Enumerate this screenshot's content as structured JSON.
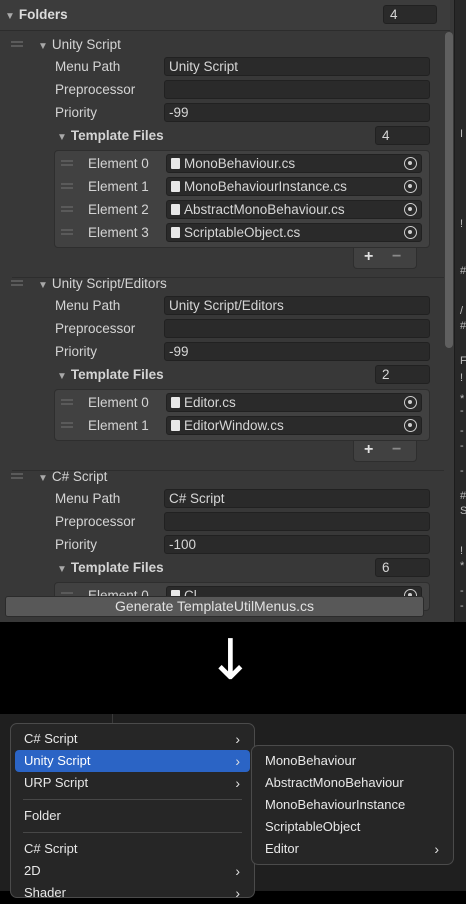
{
  "folders": {
    "header": "Folders",
    "count": "4"
  },
  "blocks": [
    {
      "title": "Unity Script",
      "labels": {
        "menu_path": "Menu Path",
        "preprocessor": "Preprocessor",
        "priority": "Priority"
      },
      "menu_path": "Unity Script",
      "preprocessor": "",
      "priority": "-99",
      "template_files_label": "Template Files",
      "template_count": "4",
      "elements": [
        {
          "label": "Element 0",
          "file": "MonoBehaviour.cs"
        },
        {
          "label": "Element 1",
          "file": "MonoBehaviourInstance.cs"
        },
        {
          "label": "Element 2",
          "file": "AbstractMonoBehaviour.cs"
        },
        {
          "label": "Element 3",
          "file": "ScriptableObject.cs"
        }
      ]
    },
    {
      "title": "Unity Script/Editors",
      "labels": {
        "menu_path": "Menu Path",
        "preprocessor": "Preprocessor",
        "priority": "Priority"
      },
      "menu_path": "Unity Script/Editors",
      "preprocessor": "",
      "priority": "-99",
      "template_files_label": "Template Files",
      "template_count": "2",
      "elements": [
        {
          "label": "Element 0",
          "file": "Editor.cs"
        },
        {
          "label": "Element 1",
          "file": "EditorWindow.cs"
        }
      ]
    },
    {
      "title": "C# Script",
      "labels": {
        "menu_path": "Menu Path",
        "preprocessor": "Preprocessor",
        "priority": "Priority"
      },
      "menu_path": "C# Script",
      "preprocessor": "",
      "priority": "-100",
      "template_files_label": "Template Files",
      "template_count": "6",
      "elements": [
        {
          "label": "Element 0",
          "file": "Cl..."
        }
      ]
    }
  ],
  "list_controls": {
    "add": "+",
    "remove": "−"
  },
  "generate_button": "Generate TemplateUtilMenus.cs",
  "right_pane": [
    "I",
    "!",
    "#",
    "/",
    "#",
    "F",
    "!",
    "*",
    "-",
    "-",
    "-",
    "-",
    "#",
    "S",
    "!",
    "*",
    "-",
    "-"
  ],
  "arrow": "↓",
  "context_menu": {
    "items": [
      {
        "label": "C# Script",
        "submenu": true
      },
      {
        "label": "Unity Script",
        "submenu": true,
        "selected": true
      },
      {
        "label": "URP Script",
        "submenu": true
      },
      {
        "label": "Folder",
        "submenu": false
      },
      {
        "label": "C# Script",
        "submenu": false
      },
      {
        "label": "2D",
        "submenu": true
      },
      {
        "label": "Shader",
        "submenu": true
      }
    ],
    "chevron": "›"
  },
  "submenu": {
    "items": [
      {
        "label": "MonoBehaviour",
        "submenu": false
      },
      {
        "label": "AbstractMonoBehaviour",
        "submenu": false
      },
      {
        "label": "MonoBehaviourInstance",
        "submenu": false
      },
      {
        "label": "ScriptableObject",
        "submenu": false
      },
      {
        "label": "Editor",
        "submenu": true
      }
    ]
  },
  "colors": {
    "inspector_bg": "#383838",
    "field_bg": "#2a2a2a",
    "menu_bg": "#262626",
    "selection": "#2b64c5"
  }
}
